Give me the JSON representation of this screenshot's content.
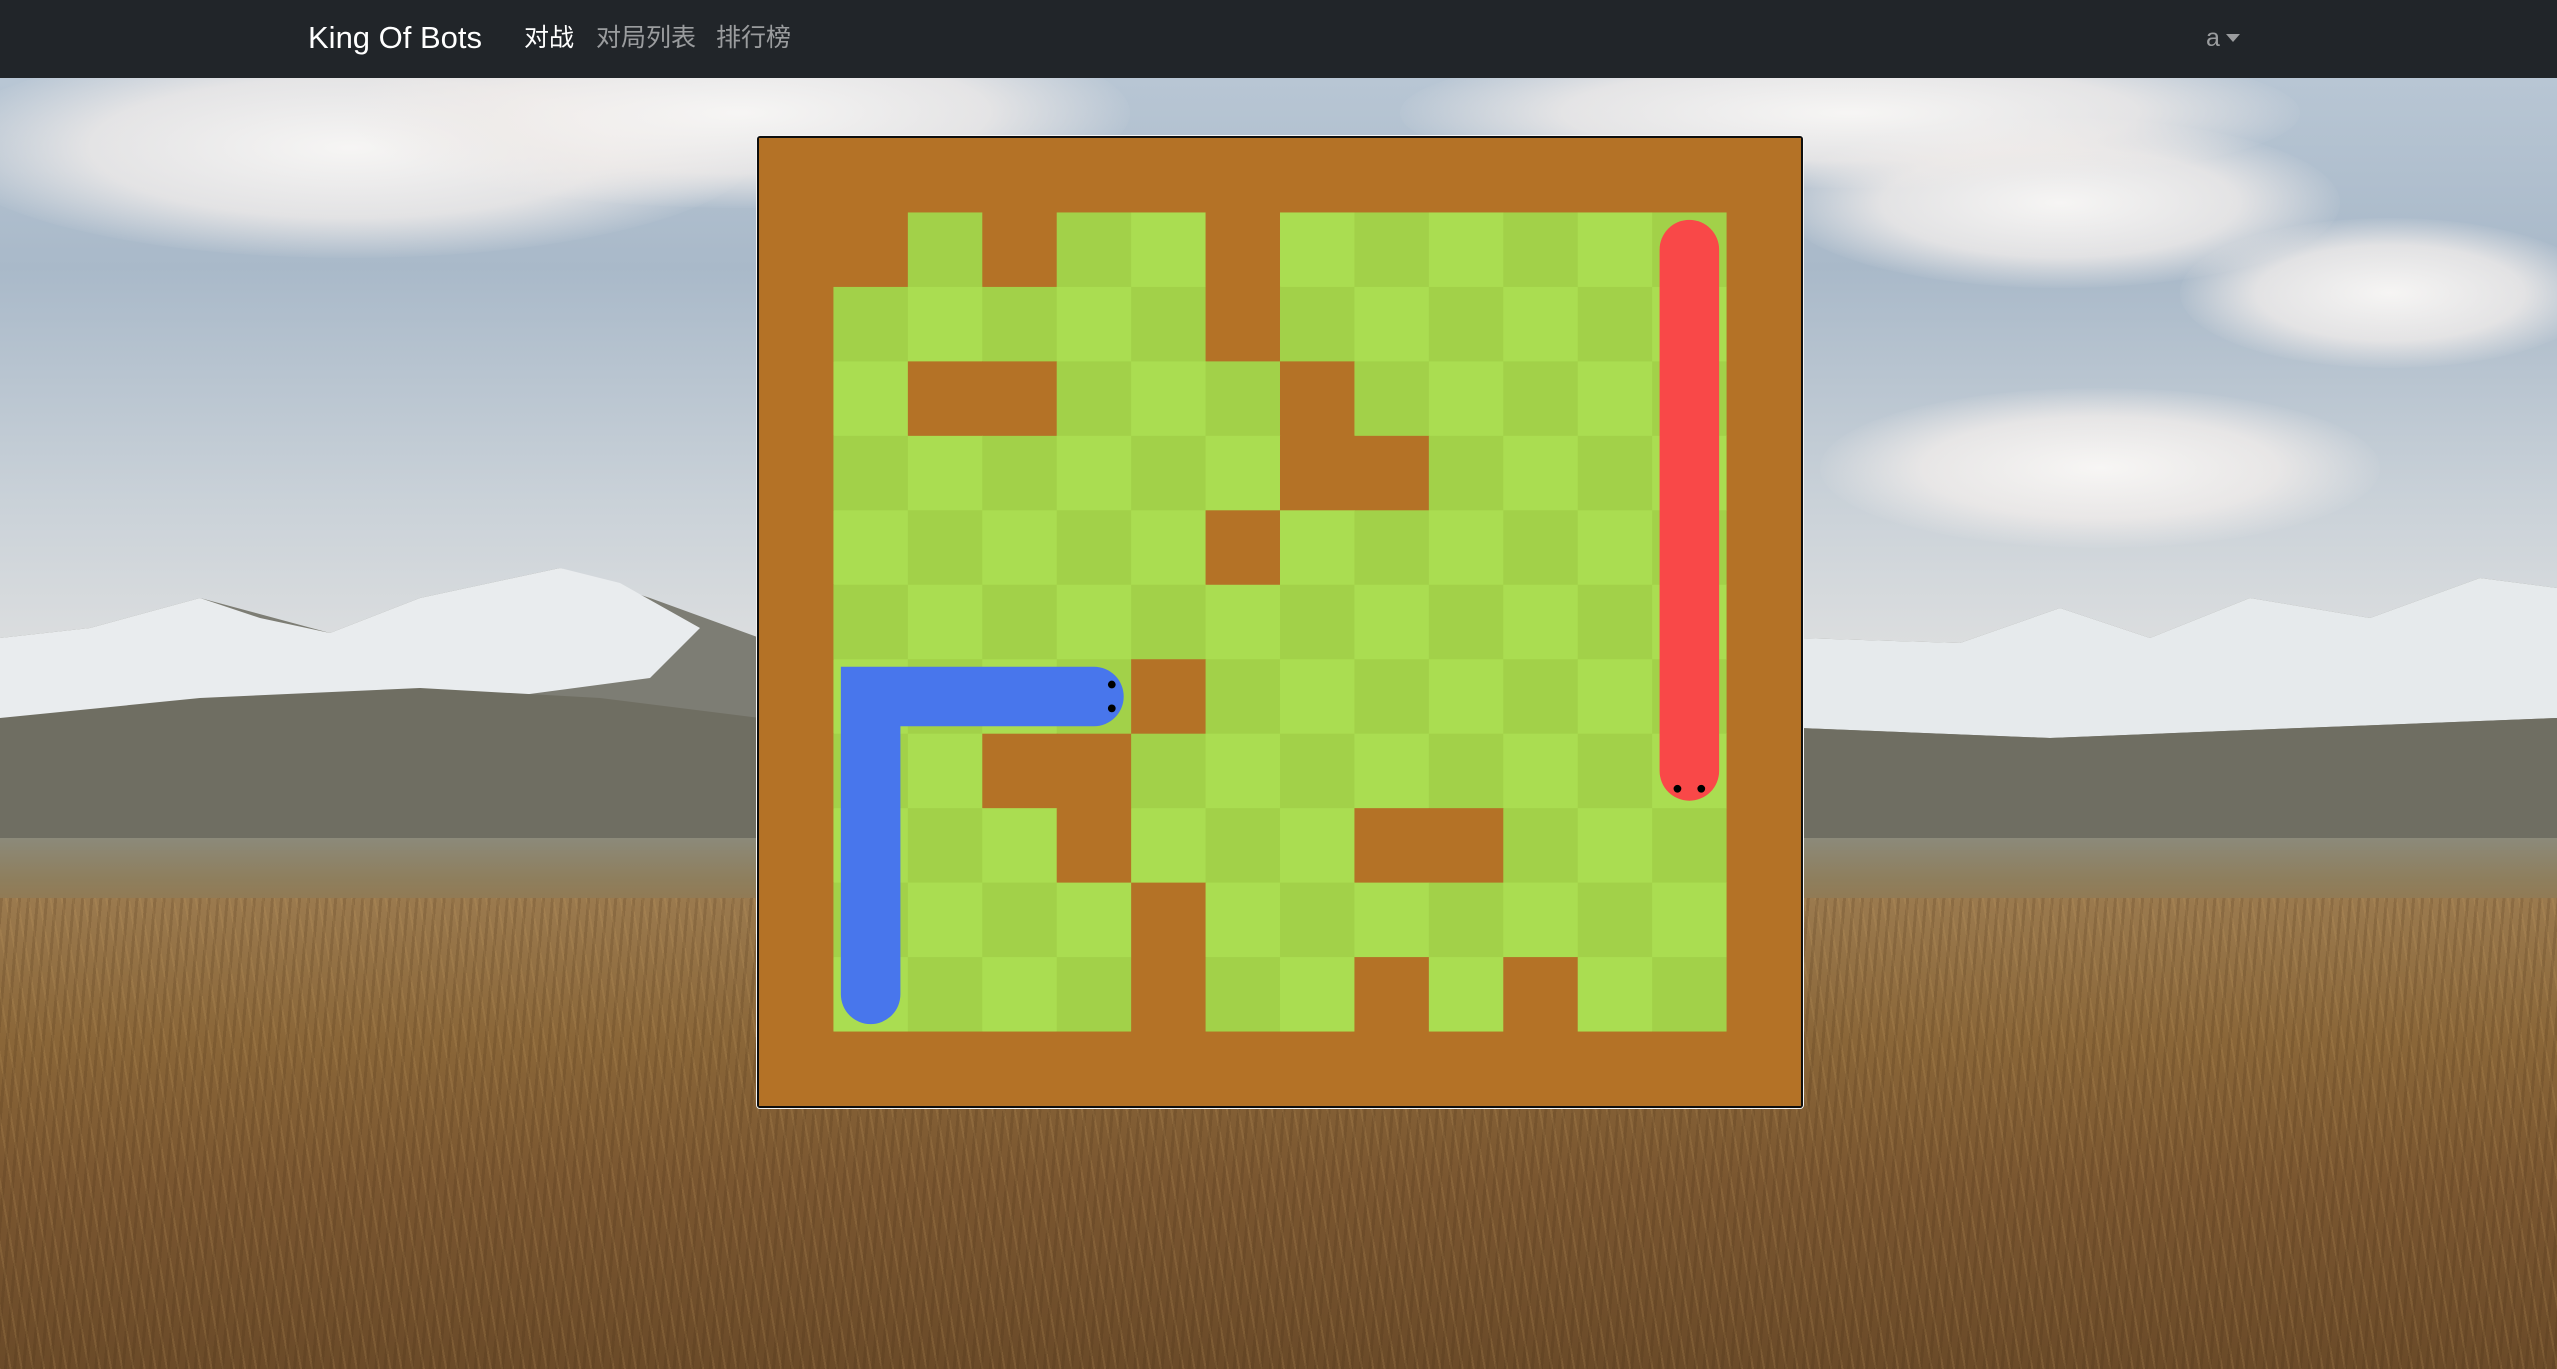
{
  "navbar": {
    "brand": "King Of Bots",
    "links": [
      {
        "label": "对战",
        "active": true
      },
      {
        "label": "对局列表",
        "active": false
      },
      {
        "label": "排行榜",
        "active": false
      }
    ],
    "user": "a"
  },
  "game": {
    "rows": 13,
    "cols": 14,
    "colors": {
      "wall": "#b47226",
      "grass_light": "#aadd51",
      "grass_dark": "#a2d149",
      "snake_a": "#4876ec",
      "snake_b": "#f94848",
      "eye": "#000000"
    },
    "walls": [
      [
        1,
        1
      ],
      [
        1,
        3
      ],
      [
        1,
        6
      ],
      [
        2,
        6
      ],
      [
        3,
        2
      ],
      [
        3,
        3
      ],
      [
        3,
        7
      ],
      [
        4,
        7
      ],
      [
        4,
        8
      ],
      [
        5,
        6
      ],
      [
        7,
        5
      ],
      [
        8,
        3
      ],
      [
        8,
        4
      ],
      [
        9,
        4
      ],
      [
        9,
        8
      ],
      [
        9,
        9
      ],
      [
        10,
        5
      ],
      [
        11,
        5
      ],
      [
        11,
        8
      ],
      [
        11,
        10
      ]
    ],
    "snakes": [
      {
        "name": "snake_a",
        "color": "snake_a",
        "cells": [
          [
            7,
            4
          ],
          [
            7,
            3
          ],
          [
            7,
            2
          ],
          [
            7,
            1
          ],
          [
            8,
            1
          ],
          [
            9,
            1
          ],
          [
            10,
            1
          ],
          [
            11,
            1
          ]
        ],
        "eyes": "right"
      },
      {
        "name": "snake_b",
        "color": "snake_b",
        "cells": [
          [
            8,
            12
          ],
          [
            7,
            12
          ],
          [
            6,
            12
          ],
          [
            5,
            12
          ],
          [
            4,
            12
          ],
          [
            3,
            12
          ],
          [
            2,
            12
          ],
          [
            1,
            12
          ]
        ],
        "eyes": "down"
      }
    ]
  }
}
